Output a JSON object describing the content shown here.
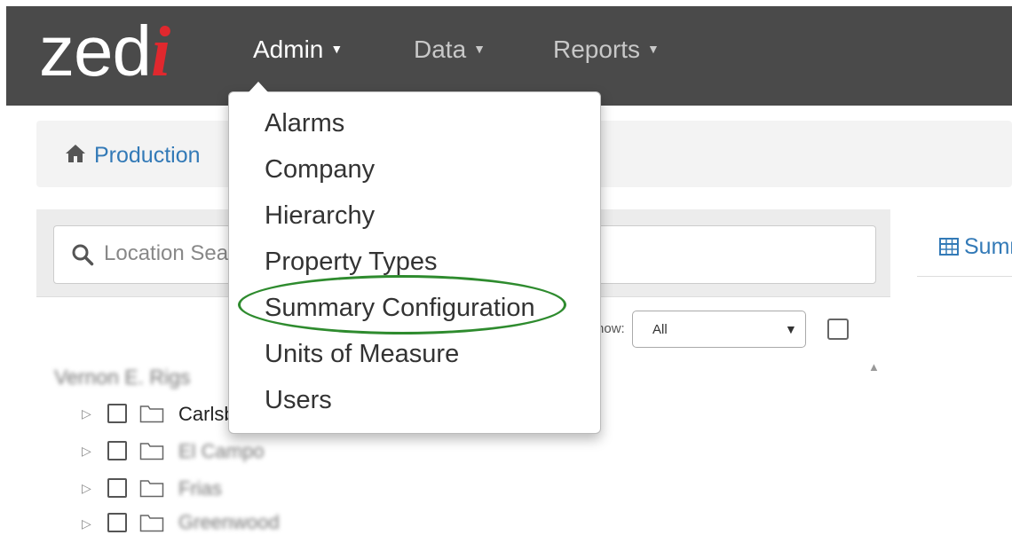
{
  "brand": {
    "logo_text": "zed",
    "logo_accent": "i",
    "accent_color": "#e0282e"
  },
  "navbar": {
    "items": [
      {
        "label": "Admin",
        "icon": "caret-down-icon",
        "active": true
      },
      {
        "label": "Data",
        "icon": "caret-down-icon",
        "active": false
      },
      {
        "label": "Reports",
        "icon": "caret-down-icon",
        "active": false
      }
    ]
  },
  "breadcrumb": {
    "icon": "home-icon",
    "label": "Production"
  },
  "search": {
    "icon": "search-icon",
    "placeholder": "Location Search"
  },
  "filter": {
    "label": "Show:",
    "selected": "All",
    "options": [
      "All"
    ]
  },
  "tree": {
    "root_label": "Vernon E. Rigs",
    "nodes": [
      {
        "label": "Carlsbad",
        "blurred": false
      },
      {
        "label": "El Campo",
        "blurred": true
      },
      {
        "label": "Frias",
        "blurred": true
      },
      {
        "label": "Greenwood",
        "blurred": true
      }
    ]
  },
  "right_panel": {
    "tab_icon": "table-icon",
    "tab_label": "Summary"
  },
  "admin_menu": {
    "items": [
      "Alarms",
      "Company",
      "Hierarchy",
      "Property Types",
      "Summary Configuration",
      "Units of Measure",
      "Users"
    ],
    "highlighted": "Summary Configuration",
    "highlight_color": "#2e8b2e"
  }
}
